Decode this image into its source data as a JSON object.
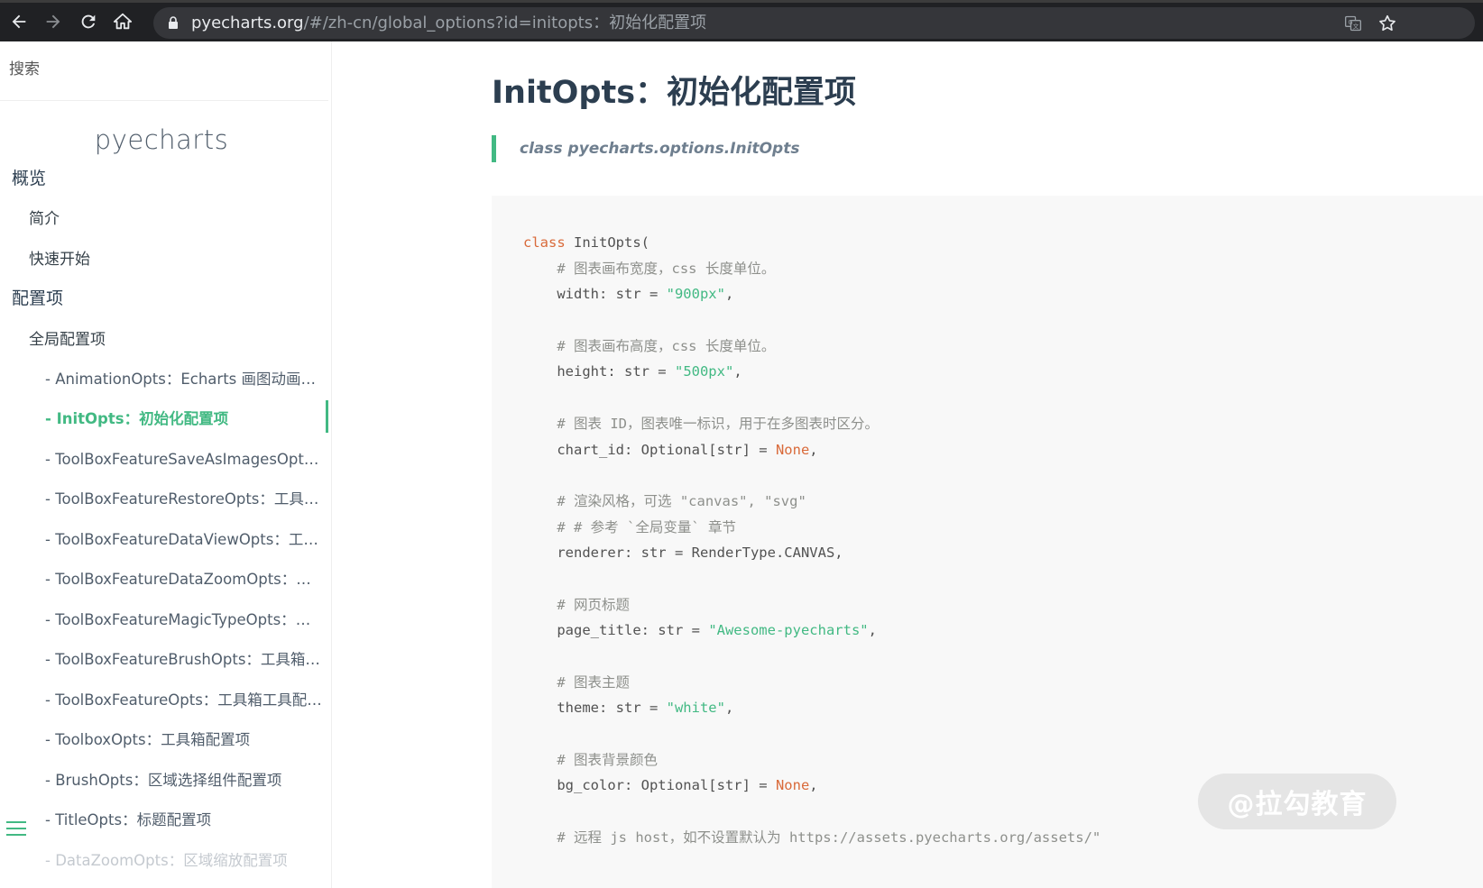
{
  "browser": {
    "url_host": "pyecharts.org",
    "url_path": "/#/zh-cn/global_options?id=initopts：初始化配置项"
  },
  "sidebar": {
    "search_placeholder": "搜索",
    "app_name": "pyecharts",
    "items": [
      {
        "level": 1,
        "label": "概览"
      },
      {
        "level": 2,
        "label": "简介"
      },
      {
        "level": 2,
        "label": "快速开始"
      },
      {
        "level": 1,
        "label": "配置项"
      },
      {
        "level": 2,
        "label": "全局配置项"
      },
      {
        "level": 3,
        "label": "- AnimationOpts：Echarts 画图动画配置项"
      },
      {
        "level": 3,
        "label": "- InitOpts：初始化配置项",
        "active": true
      },
      {
        "level": 3,
        "label": "- ToolBoxFeatureSaveAsImagesOpts：工具箱保存图片配置项"
      },
      {
        "level": 3,
        "label": "- ToolBoxFeatureRestoreOpts：工具箱还原配置项"
      },
      {
        "level": 3,
        "label": "- ToolBoxFeatureDataViewOpts：工具箱数据视图工具"
      },
      {
        "level": 3,
        "label": "- ToolBoxFeatureDataZoomOpts：工具箱区域缩放配置项"
      },
      {
        "level": 3,
        "label": "- ToolBoxFeatureMagicTypeOpts：工具箱动态类型切换配置项"
      },
      {
        "level": 3,
        "label": "- ToolBoxFeatureBrushOpts：工具箱选框组件配置项"
      },
      {
        "level": 3,
        "label": "- ToolBoxFeatureOpts：工具箱工具配置项"
      },
      {
        "level": 3,
        "label": "- ToolboxOpts：工具箱配置项"
      },
      {
        "level": 3,
        "label": "- BrushOpts：区域选择组件配置项"
      },
      {
        "level": 3,
        "label": "- TitleOpts：标题配置项"
      },
      {
        "level": 3,
        "label": "- DataZoomOpts：区域缩放配置项",
        "faded": true
      }
    ]
  },
  "main": {
    "title": "InitOpts：初始化配置项",
    "quote": "class pyecharts.options.InitOpts",
    "code_lines": [
      [
        [
          "kw",
          "class"
        ],
        [
          "plain",
          " InitOpts("
        ]
      ],
      [
        [
          "com",
          "    # 图表画布宽度，css 长度单位。"
        ]
      ],
      [
        [
          "plain",
          "    width: str = "
        ],
        [
          "str",
          "\"900px\""
        ],
        [
          "plain",
          ","
        ]
      ],
      [],
      [
        [
          "com",
          "    # 图表画布高度，css 长度单位。"
        ]
      ],
      [
        [
          "plain",
          "    height: str = "
        ],
        [
          "str",
          "\"500px\""
        ],
        [
          "plain",
          ","
        ]
      ],
      [],
      [
        [
          "com",
          "    # 图表 ID，图表唯一标识，用于在多图表时区分。"
        ]
      ],
      [
        [
          "plain",
          "    chart_id: Optional[str] = "
        ],
        [
          "const",
          "None"
        ],
        [
          "plain",
          ","
        ]
      ],
      [],
      [
        [
          "com",
          "    # 渲染风格，可选 \"canvas\", \"svg\""
        ]
      ],
      [
        [
          "com",
          "    # # 参考 `全局变量` 章节"
        ]
      ],
      [
        [
          "plain",
          "    renderer: str = RenderType.CANVAS,"
        ]
      ],
      [],
      [
        [
          "com",
          "    # 网页标题"
        ]
      ],
      [
        [
          "plain",
          "    page_title: str = "
        ],
        [
          "str",
          "\"Awesome-pyecharts\""
        ],
        [
          "plain",
          ","
        ]
      ],
      [],
      [
        [
          "com",
          "    # 图表主题"
        ]
      ],
      [
        [
          "plain",
          "    theme: str = "
        ],
        [
          "str",
          "\"white\""
        ],
        [
          "plain",
          ","
        ]
      ],
      [],
      [
        [
          "com",
          "    # 图表背景颜色"
        ]
      ],
      [
        [
          "plain",
          "    bg_color: Optional[str] = "
        ],
        [
          "const",
          "None"
        ],
        [
          "plain",
          ","
        ]
      ],
      [],
      [
        [
          "com",
          "    # 远程 js host，如不设置默认为 https://assets.pyecharts.org/assets/\""
        ]
      ]
    ]
  },
  "watermark": "@拉勾教育",
  "colors": {
    "accent": "#42b983",
    "keyword": "#d96a3a",
    "comment": "#8e908c",
    "code_bg": "#f8f8f8"
  }
}
